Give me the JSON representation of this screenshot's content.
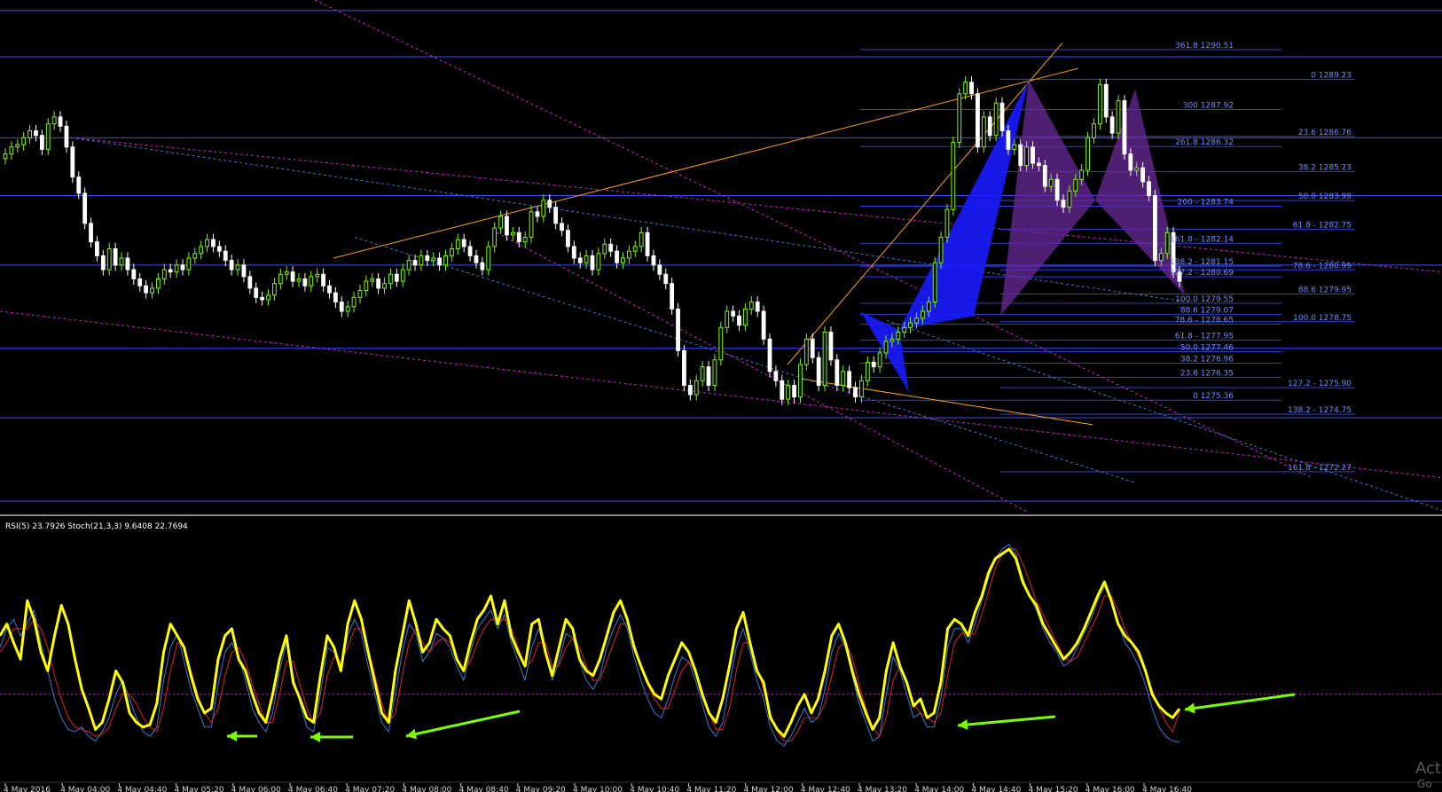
{
  "indicator_header": "RSI(5) 23.7926  Stoch(21,3,3) 9.6408 22.7694",
  "watermark": {
    "line1": "Act",
    "line2": "Go"
  },
  "colors": {
    "background": "#000000",
    "candle_up": "#7CFC00",
    "candle_down": "#ffffff",
    "level_line": "#3b4cff",
    "level_label": "#6f8cff",
    "trend_orange": "#ffa500",
    "trend_magenta": "#d020d0",
    "trend_blue": "#3a7bd5",
    "pattern_blue": "#1a1aff",
    "pattern_purple": "#6a2a9a",
    "rsi": "#ffff00",
    "stoch_main": "#3a7bd5",
    "stoch_signal": "#e02020",
    "arrow": "#7CFC00"
  },
  "chart_data": [
    {
      "type": "candlestick",
      "title": "",
      "x_ticks": [
        "4 May 2016",
        "4 May 04:00",
        "4 May 04:40",
        "4 May 05:20",
        "4 May 06:00",
        "4 May 06:40",
        "4 May 07:20",
        "4 May 08:00",
        "4 May 08:40",
        "4 May 09:20",
        "4 May 10:00",
        "4 May 10:40",
        "4 May 11:20",
        "4 May 12:00",
        "4 May 12:40",
        "4 May 13:20",
        "4 May 14:00",
        "4 May 14:40",
        "4 May 15:20",
        "4 May 16:00",
        "4 May 16:40"
      ],
      "y_range": [
        1270.5,
        1292.5
      ],
      "close": [
        1286.0,
        1286.3,
        1286.4,
        1286.7,
        1287.0,
        1286.8,
        1286.2,
        1287.3,
        1287.6,
        1287.2,
        1286.3,
        1285.0,
        1284.3,
        1283.0,
        1282.2,
        1281.6,
        1281.0,
        1281.9,
        1281.2,
        1281.5,
        1281.0,
        1280.6,
        1280.3,
        1280.0,
        1280.2,
        1280.6,
        1281.0,
        1280.9,
        1281.2,
        1281.0,
        1281.5,
        1281.7,
        1282.0,
        1282.3,
        1282.0,
        1281.8,
        1281.4,
        1281.0,
        1281.2,
        1280.7,
        1280.2,
        1279.8,
        1279.7,
        1279.9,
        1280.4,
        1280.8,
        1280.9,
        1280.5,
        1280.6,
        1280.3,
        1280.7,
        1280.8,
        1280.3,
        1280.0,
        1279.6,
        1279.2,
        1279.4,
        1279.8,
        1280.1,
        1280.5,
        1280.6,
        1280.2,
        1280.4,
        1280.8,
        1280.5,
        1281.0,
        1281.4,
        1281.2,
        1281.6,
        1281.4,
        1281.5,
        1281.2,
        1281.6,
        1281.9,
        1282.3,
        1282.0,
        1281.6,
        1281.3,
        1281.0,
        1282.0,
        1282.8,
        1283.3,
        1282.5,
        1282.6,
        1282.2,
        1282.4,
        1283.5,
        1283.3,
        1284.0,
        1283.7,
        1283.0,
        1282.7,
        1282.0,
        1281.5,
        1281.3,
        1281.6,
        1281.0,
        1281.7,
        1282.1,
        1281.8,
        1281.3,
        1281.5,
        1281.8,
        1282.0,
        1282.6,
        1281.6,
        1281.2,
        1280.8,
        1280.4,
        1279.3,
        1277.5,
        1276.0,
        1275.6,
        1276.2,
        1276.8,
        1276.0,
        1277.1,
        1278.5,
        1279.2,
        1279.0,
        1278.6,
        1279.3,
        1279.6,
        1279.2,
        1278.0,
        1276.6,
        1276.2,
        1275.4,
        1276.0,
        1275.5,
        1276.9,
        1278.0,
        1277.2,
        1276.0,
        1278.3,
        1277.1,
        1276.0,
        1276.6,
        1275.9,
        1275.5,
        1276.2,
        1277.0,
        1276.8,
        1277.4,
        1277.9,
        1278.0,
        1278.3,
        1278.5,
        1278.7,
        1278.9,
        1279.2,
        1279.6,
        1281.3,
        1282.4,
        1283.6,
        1286.5,
        1288.6,
        1289.1,
        1288.6,
        1286.3,
        1287.6,
        1286.8,
        1288.2,
        1287.0,
        1286.2,
        1286.4,
        1285.5,
        1286.3,
        1285.6,
        1285.5,
        1284.6,
        1284.9,
        1284.0,
        1283.7,
        1284.4,
        1284.9,
        1285.3,
        1286.7,
        1287.3,
        1289.0,
        1287.6,
        1286.9,
        1288.3,
        1286.0,
        1285.3,
        1285.4,
        1284.8,
        1284.2,
        1281.4,
        1281.7,
        1282.6,
        1280.9,
        1280.5
      ]
    },
    {
      "type": "line",
      "title": "RSI(5) / Stoch(21,3,3)",
      "y_range": [
        0,
        100
      ],
      "level": 30,
      "rsi_current": 23.7926,
      "stoch_main_current": 9.6408,
      "stoch_signal_current": 22.7694,
      "series": [
        {
          "name": "RSI(5)",
          "values": [
            55,
            60,
            52,
            45,
            70,
            62,
            48,
            40,
            55,
            68,
            60,
            45,
            32,
            24,
            15,
            18,
            28,
            40,
            35,
            22,
            18,
            16,
            17,
            26,
            48,
            60,
            55,
            50,
            38,
            28,
            22,
            24,
            45,
            55,
            58,
            45,
            40,
            30,
            22,
            18,
            30,
            45,
            55,
            35,
            28,
            20,
            18,
            38,
            55,
            50,
            40,
            60,
            70,
            62,
            48,
            35,
            22,
            18,
            40,
            55,
            70,
            60,
            48,
            52,
            62,
            58,
            55,
            45,
            40,
            52,
            62,
            66,
            72,
            60,
            70,
            55,
            48,
            42,
            60,
            62,
            48,
            38,
            50,
            62,
            58,
            45,
            40,
            38,
            45,
            55,
            65,
            70,
            62,
            50,
            42,
            35,
            30,
            28,
            38,
            45,
            52,
            48,
            40,
            30,
            22,
            18,
            28,
            42,
            58,
            65,
            52,
            40,
            35,
            20,
            15,
            12,
            18,
            25,
            30,
            22,
            28,
            40,
            55,
            60,
            52,
            40,
            30,
            22,
            15,
            20,
            40,
            52,
            42,
            35,
            25,
            28,
            20,
            22,
            35,
            58,
            62,
            60,
            55,
            65,
            72,
            82,
            88,
            90,
            92,
            88,
            78,
            72,
            68,
            60,
            55,
            50,
            45,
            48,
            52,
            58,
            65,
            72,
            78,
            70,
            60,
            55,
            52,
            48,
            40,
            30,
            25,
            22,
            20,
            23.8
          ]
        },
        {
          "name": "Stoch main",
          "values": [
            50,
            58,
            62,
            55,
            60,
            66,
            52,
            40,
            28,
            20,
            15,
            14,
            16,
            12,
            10,
            14,
            20,
            30,
            36,
            28,
            20,
            14,
            12,
            16,
            36,
            50,
            56,
            44,
            32,
            24,
            16,
            16,
            34,
            48,
            52,
            46,
            36,
            24,
            18,
            14,
            22,
            40,
            52,
            38,
            26,
            16,
            14,
            30,
            50,
            48,
            40,
            55,
            62,
            56,
            42,
            30,
            18,
            14,
            30,
            48,
            60,
            56,
            44,
            48,
            56,
            54,
            50,
            42,
            36,
            48,
            58,
            62,
            66,
            58,
            64,
            52,
            44,
            36,
            50,
            58,
            48,
            36,
            44,
            56,
            54,
            44,
            36,
            32,
            38,
            50,
            58,
            64,
            58,
            46,
            36,
            28,
            22,
            20,
            28,
            38,
            46,
            44,
            36,
            26,
            16,
            12,
            18,
            34,
            50,
            58,
            48,
            36,
            28,
            16,
            10,
            8,
            12,
            18,
            24,
            18,
            20,
            32,
            48,
            56,
            50,
            38,
            26,
            18,
            10,
            12,
            30,
            46,
            40,
            30,
            20,
            22,
            16,
            16,
            28,
            50,
            58,
            58,
            52,
            60,
            70,
            80,
            88,
            92,
            94,
            90,
            80,
            72,
            66,
            58,
            52,
            48,
            42,
            44,
            50,
            56,
            62,
            70,
            76,
            70,
            60,
            52,
            48,
            42,
            34,
            24,
            16,
            12,
            10,
            9.6
          ]
        },
        {
          "name": "Stoch signal",
          "values": [
            48,
            52,
            58,
            58,
            58,
            62,
            58,
            50,
            38,
            28,
            20,
            16,
            15,
            14,
            12,
            13,
            16,
            24,
            30,
            30,
            26,
            20,
            16,
            14,
            24,
            40,
            52,
            50,
            40,
            30,
            22,
            18,
            24,
            38,
            48,
            50,
            44,
            34,
            26,
            18,
            18,
            30,
            44,
            44,
            34,
            24,
            18,
            22,
            38,
            46,
            44,
            50,
            58,
            58,
            50,
            38,
            26,
            18,
            22,
            38,
            52,
            58,
            52,
            48,
            52,
            54,
            52,
            46,
            40,
            44,
            52,
            58,
            62,
            62,
            62,
            58,
            50,
            42,
            44,
            52,
            52,
            42,
            42,
            50,
            54,
            50,
            42,
            36,
            36,
            44,
            52,
            60,
            60,
            52,
            42,
            34,
            28,
            24,
            24,
            32,
            40,
            44,
            40,
            32,
            22,
            15,
            15,
            24,
            40,
            52,
            52,
            42,
            32,
            22,
            14,
            10,
            10,
            14,
            20,
            20,
            20,
            26,
            38,
            50,
            52,
            46,
            34,
            24,
            16,
            12,
            20,
            36,
            42,
            36,
            26,
            22,
            20,
            18,
            22,
            38,
            52,
            56,
            56,
            56,
            64,
            74,
            84,
            90,
            92,
            92,
            86,
            78,
            70,
            64,
            58,
            52,
            46,
            44,
            46,
            52,
            58,
            64,
            72,
            72,
            66,
            58,
            52,
            46,
            40,
            32,
            24,
            18,
            14,
            22.8
          ]
        }
      ]
    }
  ],
  "levels_right": [
    {
      "text": "361.8 1290.51",
      "price": 1290.51,
      "series": "A"
    },
    {
      "text": "0 1289.23",
      "price": 1289.23,
      "series": "B"
    },
    {
      "text": "300 1287.92",
      "price": 1287.92,
      "series": "A"
    },
    {
      "text": "23.6 1286.76",
      "price": 1286.76,
      "series": "B"
    },
    {
      "text": "261.8 1286.32",
      "price": 1286.32,
      "series": "A"
    },
    {
      "text": "38.2 1285.23",
      "price": 1285.23,
      "series": "B"
    },
    {
      "text": "50.0 1283.99",
      "price": 1283.99,
      "series": "B"
    },
    {
      "text": "200 - 1283.74",
      "price": 1283.74,
      "series": "A"
    },
    {
      "text": "61.8 - 1282.75",
      "price": 1282.75,
      "series": "B"
    },
    {
      "text": "161.8 - 1282.14",
      "price": 1282.14,
      "series": "A"
    },
    {
      "text": "138.2 - 1281.15",
      "price": 1281.15,
      "series": "A"
    },
    {
      "text": "78.6 - 1280.99",
      "price": 1280.99,
      "series": "B"
    },
    {
      "text": "127.2 - 1280.69",
      "price": 1280.69,
      "series": "A"
    },
    {
      "text": "88.6 1279.95",
      "price": 1279.95,
      "series": "B"
    },
    {
      "text": "100.0 1279.55",
      "price": 1279.55,
      "series": "A"
    },
    {
      "text": "88.6 1279.07",
      "price": 1279.07,
      "series": "A"
    },
    {
      "text": "78.6 - 1278.65",
      "price": 1278.65,
      "series": "A"
    },
    {
      "text": "100.0 1278.75",
      "price": 1278.75,
      "series": "B"
    },
    {
      "text": "61.8 - 1277.95",
      "price": 1277.95,
      "series": "A"
    },
    {
      "text": "50.0 1277.46",
      "price": 1277.46,
      "series": "A"
    },
    {
      "text": "38.2 1276.96",
      "price": 1276.96,
      "series": "A"
    },
    {
      "text": "23.6 1276.35",
      "price": 1276.35,
      "series": "A"
    },
    {
      "text": "127.2 - 1275.90",
      "price": 1275.9,
      "series": "B"
    },
    {
      "text": "0 1275.36",
      "price": 1275.36,
      "series": "A"
    },
    {
      "text": "138.2 - 1274.75",
      "price": 1274.75,
      "series": "B"
    },
    {
      "text": "161.8 - 1272.27",
      "price": 1272.27,
      "series": "C"
    }
  ]
}
